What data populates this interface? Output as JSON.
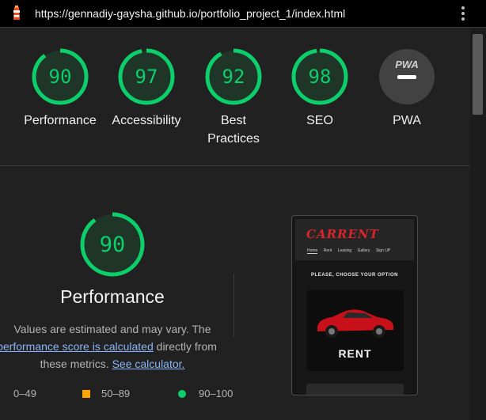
{
  "browser": {
    "url": "https://gennadiy-gaysha.github.io/portfolio_project_1/index.html",
    "lighthouse_icon": "lighthouse-icon",
    "menu_icon": "kebab-menu-icon"
  },
  "colors": {
    "pass": "#0cce6b",
    "average": "#ffa400",
    "fail": "#ff4e42",
    "link": "#8ab4f8"
  },
  "gauges": [
    {
      "id": "performance",
      "score": "90",
      "score_value": 90,
      "label": "Performance"
    },
    {
      "id": "accessibility",
      "score": "97",
      "score_value": 97,
      "label": "Accessibility"
    },
    {
      "id": "best-practices",
      "score": "92",
      "score_value": 92,
      "label": "Best Practices"
    },
    {
      "id": "seo",
      "score": "98",
      "score_value": 98,
      "label": "SEO"
    },
    {
      "id": "pwa",
      "score": "PWA",
      "label": "PWA"
    }
  ],
  "performance_section": {
    "score": "90",
    "score_value": 90,
    "title": "Performance",
    "desc_part1": "Values are estimated and may vary. The",
    "desc_link1": "performance score is calculated",
    "desc_part2": "directly from these metrics.",
    "desc_link2": "See calculator."
  },
  "legend": [
    {
      "range": "0–49"
    },
    {
      "range": "50–89"
    },
    {
      "range": "90–100"
    }
  ],
  "screenshot": {
    "brand": "CARRENT",
    "nav": [
      "Home",
      "Rent",
      "Leasing",
      "Gallery",
      "Sign UP"
    ],
    "heading": "PLEASE, CHOOSE YOUR OPTION",
    "card_label": "RENT"
  }
}
